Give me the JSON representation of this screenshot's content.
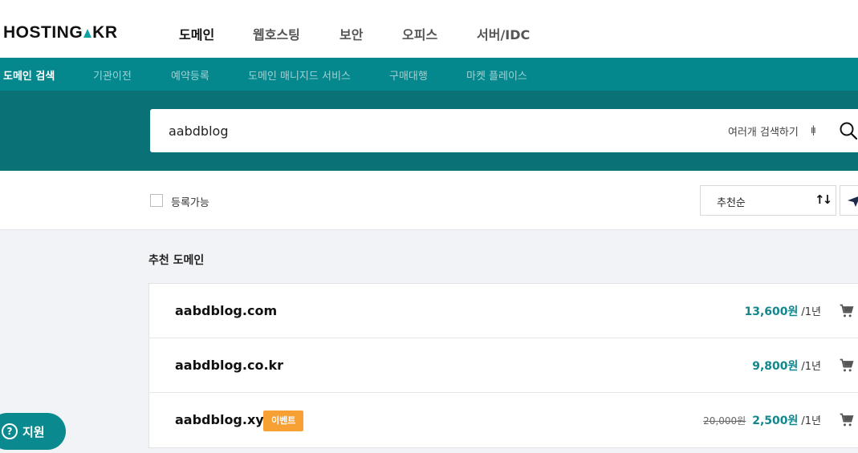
{
  "header": {
    "logo": {
      "part1": "HOSTING",
      "part2": "KR"
    },
    "nav": [
      "도메인",
      "웹호스팅",
      "보안",
      "오피스",
      "서버/IDC"
    ]
  },
  "subnav": [
    "도메인 검색",
    "기관이전",
    "예약등록",
    "도메인 매니지드 서비스",
    "구매대행",
    "마켓 플레이스"
  ],
  "search": {
    "value": "aabdblog",
    "multi_label": "여러개 검색하기"
  },
  "filter": {
    "available_label": "등록가능",
    "sort_value": "추천순"
  },
  "recommended": {
    "title": "추천 도메인",
    "domains": [
      {
        "name": "aabdblog.com",
        "price": "13,600원",
        "period": "/1년"
      },
      {
        "name": "aabdblog.co.kr",
        "price": "9,800원",
        "period": "/1년"
      },
      {
        "name": "aabdblog.xyz",
        "badge": "이벤트",
        "old_price": "20,000원",
        "price": "2,500원",
        "period": "/1년"
      }
    ]
  },
  "support": {
    "label": "지원"
  },
  "colors": {
    "accent": "#04878d",
    "band": "#0a7277",
    "event": "#f7a033",
    "price": "#11868c"
  }
}
